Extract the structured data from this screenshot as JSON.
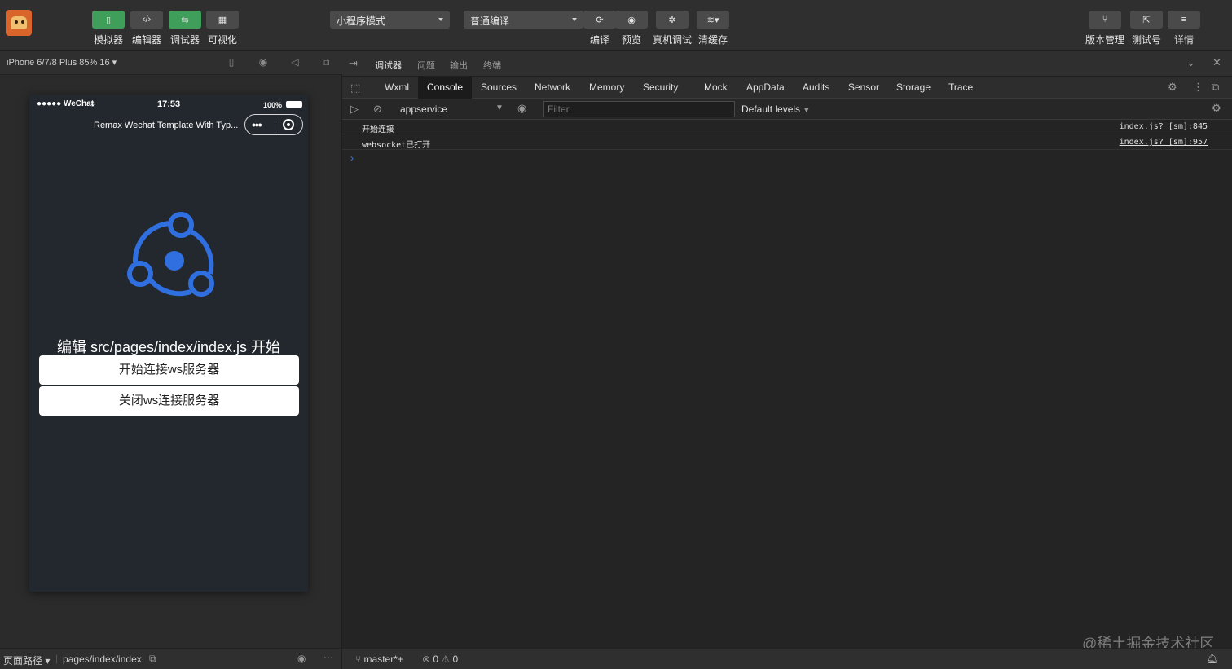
{
  "toolbar": {
    "left_tools": [
      {
        "label": "模拟器",
        "icon": "phone-icon"
      },
      {
        "label": "编辑器",
        "icon": "code-icon"
      },
      {
        "label": "调试器",
        "icon": "debug-icon"
      },
      {
        "label": "可视化",
        "icon": "layout-icon"
      }
    ],
    "mode_select": "小程序模式",
    "compile_select": "普通编译",
    "center_tools": [
      {
        "label": "编译",
        "icon": "refresh-icon"
      },
      {
        "label": "预览",
        "icon": "eye-icon"
      },
      {
        "label": "真机调试",
        "icon": "bug-icon"
      },
      {
        "label": "清缓存",
        "icon": "layers-icon"
      }
    ],
    "right_tools": [
      {
        "label": "版本管理",
        "icon": "branch-icon"
      },
      {
        "label": "测试号",
        "icon": "external-icon"
      },
      {
        "label": "详情",
        "icon": "menu-icon"
      }
    ]
  },
  "simulator": {
    "device": "iPhone 6/7/8 Plus 85% 16",
    "status_carrier": "●●●●● WeChat",
    "status_time": "17:53",
    "status_battery": "100%",
    "nav_title": "Remax Wechat Template With Typ...",
    "headline": "编辑 src/pages/index/index.js 开始",
    "buttons": [
      "开始连接ws服务器",
      "关闭ws连接服务器"
    ],
    "footer_path_label": "页面路径",
    "footer_path": "pages/index/index",
    "logo_color": "#2f6fe0"
  },
  "debugger": {
    "tabs": [
      "调试器",
      "问题",
      "输出",
      "终端"
    ],
    "devtools_tabs": [
      "Wxml",
      "Console",
      "Sources",
      "Network",
      "Memory",
      "Security",
      "Mock",
      "AppData",
      "Audits",
      "Sensor",
      "Storage",
      "Trace"
    ],
    "active_devtools_tab": "Console",
    "context": "appservice",
    "filter_placeholder": "Filter",
    "levels": "Default levels",
    "logs": [
      {
        "message": "开始连接",
        "source": "index.js? [sm]:845"
      },
      {
        "message": "websocket已打开",
        "source": "index.js? [sm]:957"
      }
    ],
    "prompt": "›",
    "branch": "master*+",
    "errors": "0",
    "warnings": "0"
  },
  "watermark": "@稀土掘金技术社区"
}
